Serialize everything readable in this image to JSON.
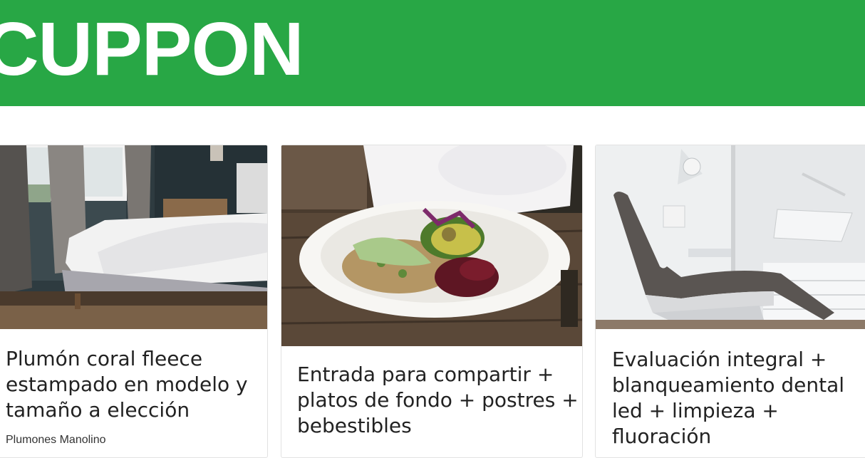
{
  "header": {
    "logo_text": "CUPPON",
    "background": "#28a745"
  },
  "deals": [
    {
      "title": "Plumón coral fleece estampado en modelo y tamaño a elección",
      "merchant": "Plumones Manolino",
      "image": "bedroom-photo"
    },
    {
      "title": "Entrada para compartir + platos de fondo + postres + bebestibles",
      "image": "food-bowl-photo"
    },
    {
      "title": "Evaluación integral + blanqueamiento dental led + limpieza + fluoración",
      "image": "dental-chair-photo"
    }
  ]
}
